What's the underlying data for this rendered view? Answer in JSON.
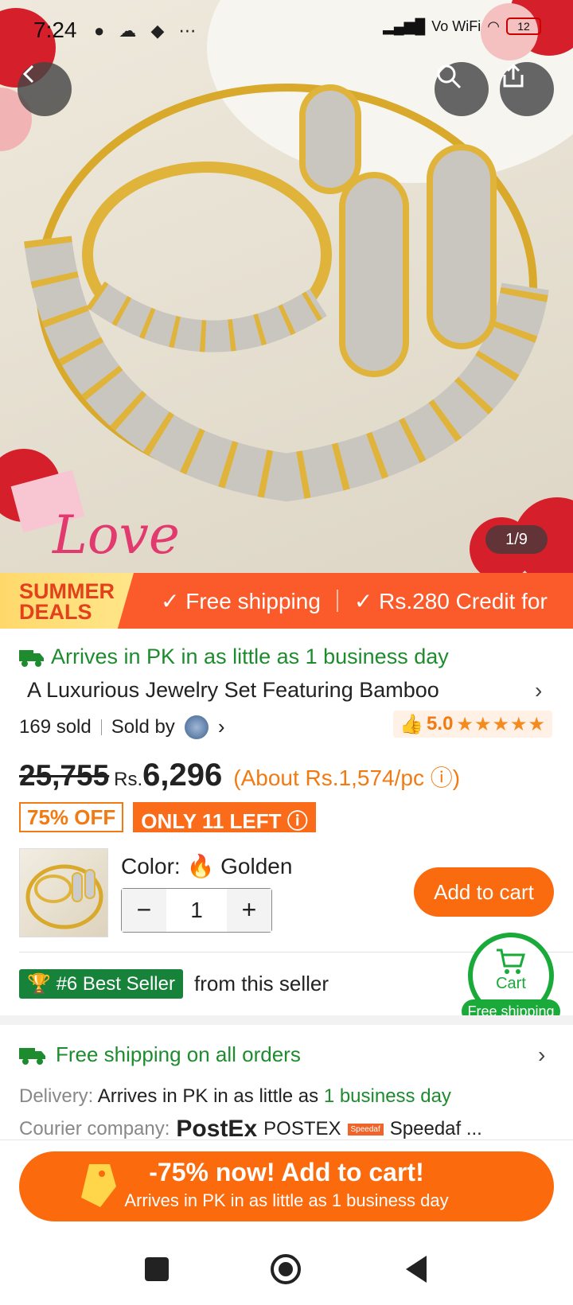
{
  "status_bar": {
    "time": "7:24",
    "battery": "12",
    "network": "Vo WiFi"
  },
  "hero": {
    "image_counter": "1/9",
    "overlay_text": "Love"
  },
  "banner": {
    "deal_line1": "SUMMER",
    "deal_line2": "DEALS",
    "item1": "✓ Free shipping",
    "item2": "✓ Rs.280 Credit for"
  },
  "product": {
    "arrival": "Arrives in PK in as little as 1 business day",
    "title": "A Luxurious Jewelry Set Featuring Bamboo",
    "sold": "169 sold",
    "sold_by": "Sold by",
    "rating": "5.0",
    "old_price": "25,755",
    "currency": "Rs.",
    "price": "6,296",
    "about": "(About Rs.1,574/pc",
    "about_close": ")",
    "discount": "75% OFF",
    "stock": "ONLY 11 LEFT",
    "color_label": "Color:",
    "color_value": "Golden",
    "quantity": "1",
    "add_to_cart": "Add to cart"
  },
  "best_seller": {
    "badge": "#6 Best Seller",
    "text": "from this seller"
  },
  "cart_float": {
    "label": "Cart",
    "sub": "Free shipping"
  },
  "shipping": {
    "title": "Free shipping on all orders",
    "delivery_label": "Delivery:",
    "delivery_text": "Arrives in PK in as little as",
    "delivery_highlight": "1 business day",
    "courier_label": "Courier company:",
    "courier1_logo": "PostEx",
    "courier1": "POSTEX",
    "courier2_logo": "Speedaf",
    "courier2": "Speedaf ..."
  },
  "cta": {
    "line1": "-75% now! Add to cart!",
    "line2": "Arrives in PK in as little as 1 business day"
  },
  "colors": {
    "accent": "#fb6a0c",
    "green": "#1e8c2e",
    "banner": "#fb5a2a"
  }
}
